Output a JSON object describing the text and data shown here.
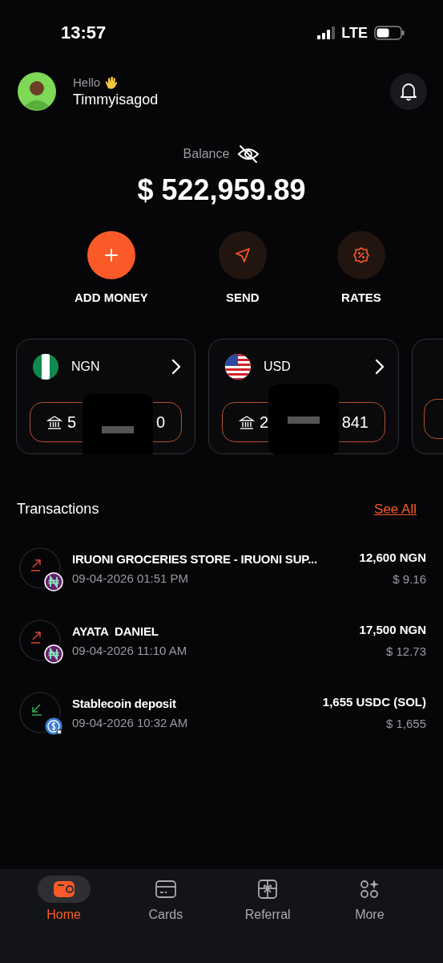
{
  "status_bar": {
    "time": "13:57",
    "network": "LTE"
  },
  "header": {
    "greeting": "Hello",
    "username": "Timmyisagod"
  },
  "balance": {
    "label": "Balance",
    "amount": "$ 522,959.89"
  },
  "actions": [
    {
      "label": "ADD MONEY",
      "kind": "add"
    },
    {
      "label": "SEND",
      "kind": "send"
    },
    {
      "label": "RATES",
      "kind": "rates"
    }
  ],
  "accounts": [
    {
      "kind": "naira",
      "currency": "NGN",
      "number_start": "5",
      "number_end": "0",
      "redacted": true
    },
    {
      "kind": "dollar",
      "currency": "USD",
      "number_start": "2",
      "number_end": "841",
      "redacted": true
    },
    {
      "kind": "partial"
    }
  ],
  "transactions": {
    "title": "Transactions",
    "see_all": "See All",
    "items": [
      {
        "title": "IRUONI GROCERIES STORE - IRUONI SUP...",
        "datetime": "09-04-2026 01:51 PM",
        "amount": "12,600 NGN",
        "amount_usd": "$ 9.16",
        "kind": "transfer"
      },
      {
        "title": "AYATA  DANIEL",
        "datetime": "09-04-2026 11:10 AM",
        "amount": "17,500 NGN",
        "amount_usd": "$ 12.73",
        "kind": "transfer"
      },
      {
        "title": "Stablecoin deposit",
        "datetime": "09-04-2026 10:32 AM",
        "amount": "1,655 USDC (SOL)",
        "amount_usd": "$ 1,655",
        "kind": "deposit"
      }
    ]
  },
  "nav": [
    {
      "label": "Home",
      "kind": "wallet",
      "selected": true
    },
    {
      "label": "Cards",
      "kind": "card",
      "selected": false
    },
    {
      "label": "Referral",
      "kind": "gift",
      "selected": false
    },
    {
      "label": "More",
      "kind": "more",
      "selected": false
    }
  ]
}
